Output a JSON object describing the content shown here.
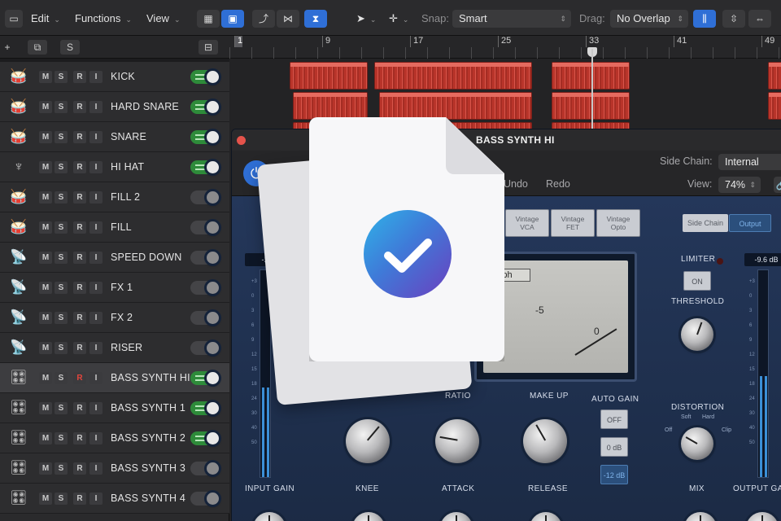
{
  "toolbar": {
    "edit_label": "Edit",
    "functions_label": "Functions",
    "view_label": "View",
    "snap_label": "Snap:",
    "snap_value": "Smart",
    "drag_label": "Drag:",
    "drag_value": "No Overlap"
  },
  "track_header": {
    "add_label": "+",
    "s_label": "S"
  },
  "ruler": {
    "bars": [
      "1",
      "9",
      "17",
      "25",
      "33",
      "41",
      "49"
    ]
  },
  "tracks": [
    {
      "name": "KICK",
      "icon": "drum-icon",
      "m": "M",
      "s": "S",
      "r": "R",
      "i": "I"
    },
    {
      "name": "HARD SNARE",
      "icon": "snare-icon",
      "m": "M",
      "s": "S",
      "r": "R",
      "i": "I"
    },
    {
      "name": "SNARE",
      "icon": "snare-icon",
      "m": "M",
      "s": "S",
      "r": "R",
      "i": "I"
    },
    {
      "name": "HI HAT",
      "icon": "hihat-icon",
      "m": "M",
      "s": "S",
      "r": "R",
      "i": "I"
    },
    {
      "name": "FILL 2",
      "icon": "drumkit-icon",
      "m": "M",
      "s": "S",
      "r": "R",
      "i": "I"
    },
    {
      "name": "FILL",
      "icon": "drumkit-icon",
      "m": "M",
      "s": "S",
      "r": "R",
      "i": "I"
    },
    {
      "name": "SPEED DOWN",
      "icon": "satellite-icon",
      "m": "M",
      "s": "S",
      "r": "R",
      "i": "I"
    },
    {
      "name": "FX 1",
      "icon": "satellite-icon",
      "m": "M",
      "s": "S",
      "r": "R",
      "i": "I"
    },
    {
      "name": "FX 2",
      "icon": "satellite-icon",
      "m": "M",
      "s": "S",
      "r": "R",
      "i": "I"
    },
    {
      "name": "RISER",
      "icon": "satellite-icon",
      "m": "M",
      "s": "S",
      "r": "R",
      "i": "I"
    },
    {
      "name": "BASS SYNTH HI",
      "icon": "synth-icon",
      "m": "M",
      "s": "S",
      "r": "R",
      "i": "I"
    },
    {
      "name": "BASS SYNTH 1",
      "icon": "synth-icon",
      "m": "M",
      "s": "S",
      "r": "R",
      "i": "I"
    },
    {
      "name": "BASS SYNTH 2",
      "icon": "synth-icon",
      "m": "M",
      "s": "S",
      "r": "R",
      "i": "I"
    },
    {
      "name": "BASS SYNTH 3",
      "icon": "synth-icon",
      "m": "M",
      "s": "S",
      "r": "R",
      "i": "I"
    },
    {
      "name": "BASS SYNTH 4",
      "icon": "synth-icon",
      "m": "M",
      "s": "S",
      "r": "R",
      "i": "I"
    }
  ],
  "plugin": {
    "title": "BASS SYNTH HI",
    "side_chain_label": "Side Chain:",
    "side_chain_value": "Internal",
    "view_label": "View:",
    "view_value": "74%",
    "undo_label": "Undo",
    "redo_label": "Redo",
    "models": [
      {
        "line1": "Vintage",
        "line2": "VCA"
      },
      {
        "line1": "Vintage",
        "line2": "FET"
      },
      {
        "line1": "Vintage",
        "line2": "Opto"
      }
    ],
    "sidechain_btn": "Side Chain",
    "output_btn": "Output",
    "input_readout": "-15",
    "output_readout": "-9.6 dB",
    "graph_label": "Graph",
    "vu_minus5": "-5",
    "vu_zero": "0",
    "limiter_label": "LIMITER",
    "on_label": "ON",
    "threshold_label": "THRESHOLD",
    "ratio_label": "RATIO",
    "makeup_label": "MAKE UP",
    "auto_gain_label": "AUTO GAIN",
    "auto_gain_options": [
      "OFF",
      "0 dB",
      "-12 dB"
    ],
    "distortion_label": "DISTORTION",
    "distortion_soft": "Soft",
    "distortion_hard": "Hard",
    "distortion_off": "Off",
    "distortion_clip": "Clip",
    "input_gain_label": "INPUT GAIN",
    "knee_label": "KNEE",
    "attack_label": "ATTACK",
    "release_label": "RELEASE",
    "mix_label": "MIX",
    "output_gain_label": "OUTPUT GA"
  },
  "colors": {
    "accent": "#2f6fd6",
    "region": "#c23a30",
    "toggle_on": "#2e8b3a",
    "rec_armed": "#e2453c",
    "panel": "#1f2f48"
  }
}
